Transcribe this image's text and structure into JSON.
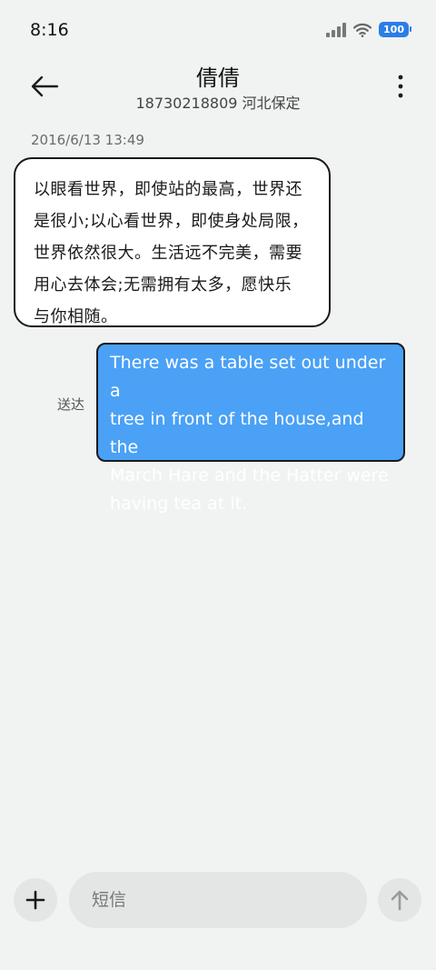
{
  "status_bar": {
    "time": "8:16",
    "battery": "100",
    "icons": [
      "signal-icon",
      "wifi-icon",
      "battery-icon"
    ]
  },
  "header": {
    "contact_name": "倩倩",
    "contact_subtitle": "18730218809 河北保定",
    "back_icon": "arrow-left-icon",
    "more_icon": "more-vertical-icon"
  },
  "conversation": {
    "timestamp": "2016/6/13 13:49",
    "incoming_message": {
      "lines": [
        "以眼看世界，即使站的最高，世界还",
        "是很小;以心看世界，即使身处局限，",
        "世界依然很大。生活远不完美，需要",
        "用心去体会;无需拥有太多，愿快乐",
        "与你相随。"
      ]
    },
    "outgoing_message": {
      "lines": [
        "There was a table set out under a",
        "tree in front of the house,and the",
        "March Hare and the Hatter were",
        "having tea at it."
      ],
      "status": "送达"
    }
  },
  "composer": {
    "placeholder": "短信",
    "value": "",
    "add_icon": "plus-icon",
    "send_icon": "arrow-up-icon"
  },
  "colors": {
    "background": "#f1f2f2",
    "outgoing_bubble": "#4aa1f6",
    "incoming_bubble": "#ffffff",
    "battery": "#2b7de8"
  }
}
